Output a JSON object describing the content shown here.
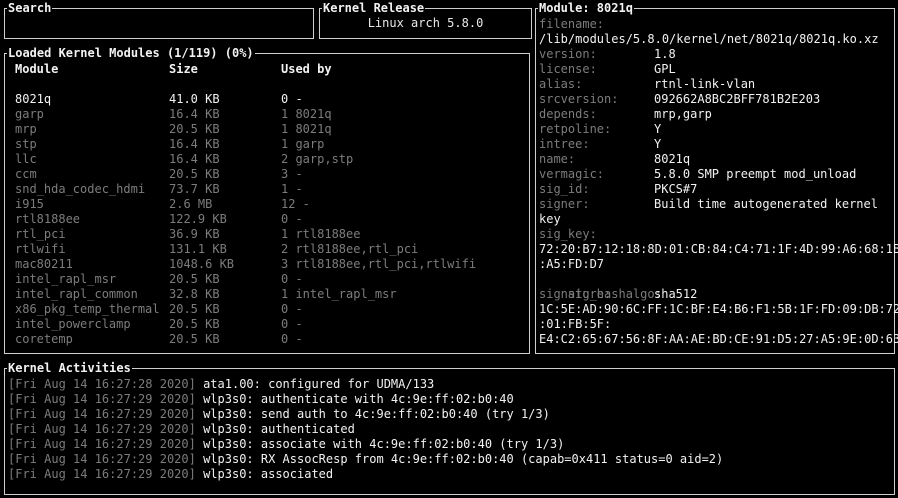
{
  "search": {
    "title": "Search",
    "value": ""
  },
  "kernel_release": {
    "title": "Kernel Release",
    "value": "Linux arch 5.8.0"
  },
  "modules": {
    "title": "Loaded Kernel Modules (1/119) (0%)",
    "headers": {
      "module": "Module",
      "size": "Size",
      "used_by": "Used by"
    },
    "rows": [
      {
        "name": "8021q",
        "size": "41.0 KB",
        "used": "0 -",
        "selected": true
      },
      {
        "name": "garp",
        "size": "16.4 KB",
        "used": "1 8021q"
      },
      {
        "name": "mrp",
        "size": "20.5 KB",
        "used": "1 8021q"
      },
      {
        "name": "stp",
        "size": "16.4 KB",
        "used": "1 garp"
      },
      {
        "name": "llc",
        "size": "16.4 KB",
        "used": "2 garp,stp"
      },
      {
        "name": "ccm",
        "size": "20.5 KB",
        "used": "3 -"
      },
      {
        "name": "snd_hda_codec_hdmi",
        "size": "73.7 KB",
        "used": "1 -"
      },
      {
        "name": "i915",
        "size": "2.6 MB",
        "used": "12 -"
      },
      {
        "name": "rtl8188ee",
        "size": "122.9 KB",
        "used": "0 -"
      },
      {
        "name": "rtl_pci",
        "size": "36.9 KB",
        "used": "1 rtl8188ee"
      },
      {
        "name": "rtlwifi",
        "size": "131.1 KB",
        "used": "2 rtl8188ee,rtl_pci"
      },
      {
        "name": "mac80211",
        "size": "1048.6 KB",
        "used": "3 rtl8188ee,rtl_pci,rtlwifi"
      },
      {
        "name": "intel_rapl_msr",
        "size": "20.5 KB",
        "used": "0 -"
      },
      {
        "name": "intel_rapl_common",
        "size": "32.8 KB",
        "used": "1 intel_rapl_msr"
      },
      {
        "name": "x86_pkg_temp_thermal",
        "size": "20.5 KB",
        "used": "0 -"
      },
      {
        "name": "intel_powerclamp",
        "size": "20.5 KB",
        "used": "0 -"
      },
      {
        "name": "coretemp",
        "size": "20.5 KB",
        "used": "0 -"
      }
    ]
  },
  "module_info": {
    "title": "Module: 8021q",
    "filename_label": "filename:",
    "filename": "/lib/modules/5.8.0/kernel/net/8021q/8021q.ko.xz",
    "fields": [
      {
        "label": "version:",
        "value": "1.8"
      },
      {
        "label": "license:",
        "value": "GPL"
      },
      {
        "label": "alias:",
        "value": "rtnl-link-vlan"
      },
      {
        "label": "srcversion:",
        "value": "092662A8BC2BFF781B2E203"
      },
      {
        "label": "depends:",
        "value": "mrp,garp"
      },
      {
        "label": "retpoline:",
        "value": "Y"
      },
      {
        "label": "intree:",
        "value": "Y"
      },
      {
        "label": "name:",
        "value": "8021q"
      },
      {
        "label": "vermagic:",
        "value": "5.8.0 SMP preempt mod_unload"
      },
      {
        "label": "sig_id:",
        "value": "PKCS#7"
      },
      {
        "label": "signer:",
        "value": "Build time autogenerated kernel"
      }
    ],
    "signer_cont": "key",
    "sig_key_label": "sig_key:",
    "sig_key": [
      "72:20:B7:12:18:8D:01:CB:84:C4:71:1F:4D:99:A6:68:1B",
      ":A5:FD:D7"
    ],
    "sig_hashalgo_label": "sig_hashalgo:",
    "sig_hashalgo": "sha512",
    "signature_label": "signature:",
    "signature": [
      "1C:5E:AD:90:6C:FF:1C:BF:E4:B6:F1:5B:1F:FD:09:DB:72",
      ":01:FB:5F:",
      "E4:C2:65:67:56:8F:AA:AE:BD:CE:91:D5:27:A5:9E:0D:63"
    ]
  },
  "activities": {
    "title": "Kernel Activities",
    "lines": [
      {
        "time": "[Fri Aug 14 16:27:28 2020]",
        "msg": "ata1.00: configured for UDMA/133"
      },
      {
        "time": "[Fri Aug 14 16:27:29 2020]",
        "msg": "wlp3s0: authenticate with 4c:9e:ff:02:b0:40"
      },
      {
        "time": "[Fri Aug 14 16:27:29 2020]",
        "msg": "wlp3s0: send auth to 4c:9e:ff:02:b0:40 (try 1/3)"
      },
      {
        "time": "[Fri Aug 14 16:27:29 2020]",
        "msg": "wlp3s0: authenticated"
      },
      {
        "time": "[Fri Aug 14 16:27:29 2020]",
        "msg": "wlp3s0: associate with 4c:9e:ff:02:b0:40 (try 1/3)"
      },
      {
        "time": "[Fri Aug 14 16:27:29 2020]",
        "msg": "wlp3s0: RX AssocResp from 4c:9e:ff:02:b0:40 (capab=0x411 status=0 aid=2)"
      },
      {
        "time": "[Fri Aug 14 16:27:29 2020]",
        "msg": "wlp3s0: associated"
      }
    ]
  }
}
